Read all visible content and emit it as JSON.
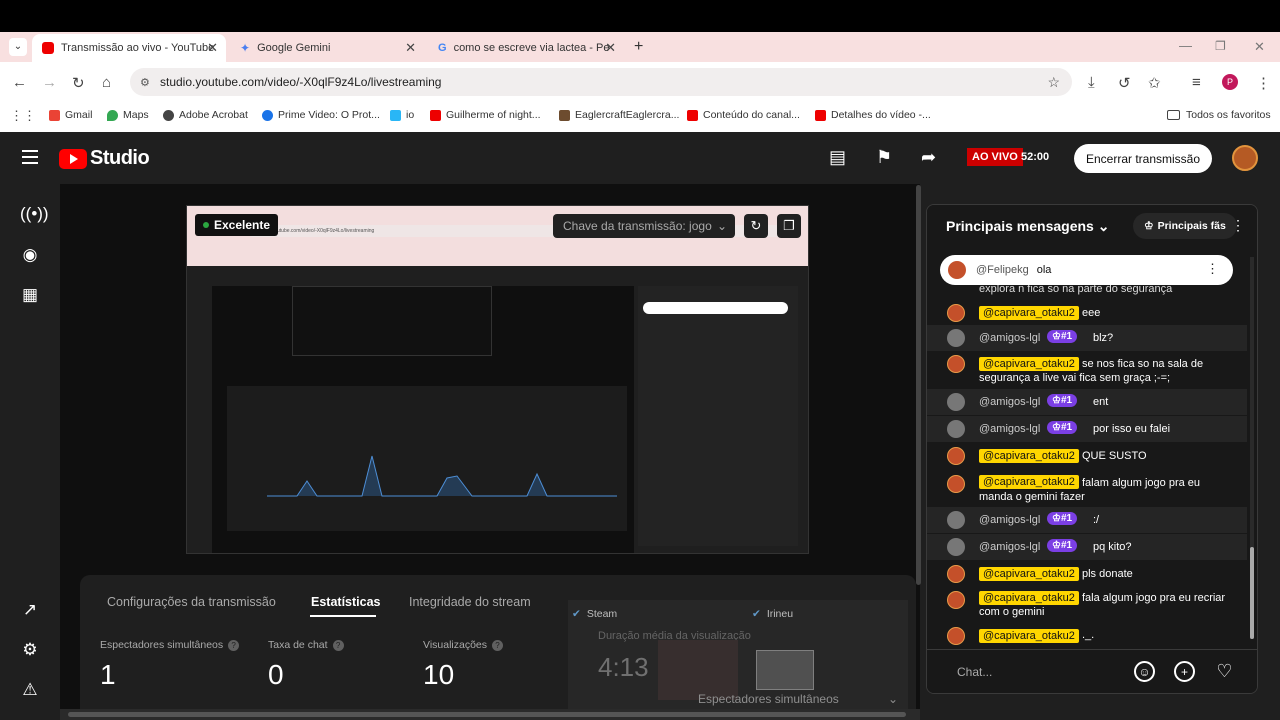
{
  "browser": {
    "tabs": [
      {
        "label": "Transmissão ao vivo - YouTube",
        "active": true,
        "favicon_color": "#e00"
      },
      {
        "label": "Google Gemini",
        "active": false,
        "favicon_color": "#4a7ef0"
      },
      {
        "label": "como se escreve via lactea - Pe",
        "active": false,
        "favicon_color": "#34a853"
      }
    ],
    "url": "studio.youtube.com/video/-X0qlF9z4Lo/livestreaming",
    "profile_initial": "P",
    "bookmarks": [
      {
        "label": "Gmail",
        "color": "#ea4335"
      },
      {
        "label": "Maps",
        "color": "#34a853"
      },
      {
        "label": "Adobe Acrobat",
        "color": "#444"
      },
      {
        "label": "Prime Video: O Prot...",
        "color": "#1a73e8"
      },
      {
        "label": "io",
        "color": "#29b6f6"
      },
      {
        "label": "Guilherme of night...",
        "color": "#e00"
      },
      {
        "label": "EaglercraftEaglercra...",
        "color": "#6d4c2f"
      },
      {
        "label": "Conteúdo do canal...",
        "color": "#e00"
      },
      {
        "label": "Detalhes do vídeo -...",
        "color": "#e00"
      }
    ],
    "all_bookmarks": "Todos os favoritos"
  },
  "studio": {
    "logo_text": "Studio",
    "live_badge": "AO VIVO",
    "live_time": "52:00",
    "end_button": "Encerrar transmissão"
  },
  "preview": {
    "quality": "Excelente",
    "stream_key": "Chave da transmissão: jogo"
  },
  "stats": {
    "tabs": [
      "Configurações da transmissão",
      "Estatísticas",
      "Integridade do stream"
    ],
    "metrics": [
      {
        "label": "Espectadores simultâneos",
        "value": "1"
      },
      {
        "label": "Taxa de chat",
        "value": "0"
      },
      {
        "label": "Visualizações",
        "value": "10"
      }
    ],
    "overlay": {
      "steam": "Steam",
      "irineu": "Irineu",
      "ghost_label": "Duração média da visualização",
      "ghost_value": "4:13",
      "ghost_bottom": "Espectadores simultâneos"
    }
  },
  "chat": {
    "title": "Principais mensagens",
    "top_fans": "Principais fãs",
    "pinned": {
      "user": "@Felipekg",
      "text": "ola"
    },
    "partial_line": "explora n fica so na parte do segurança",
    "messages": [
      {
        "user": "@capivara_otaku2",
        "style": "yellow",
        "badge": "",
        "text": "eee"
      },
      {
        "user": "@amigos-lgl",
        "style": "white",
        "badge": "#1",
        "text": "blz?"
      },
      {
        "user": "@capivara_otaku2",
        "style": "yellow",
        "badge": "",
        "text": "se nos fica so na sala de segurança a live vai fica sem graça ;-=;"
      },
      {
        "user": "@amigos-lgl",
        "style": "white",
        "badge": "#1",
        "text": "ent"
      },
      {
        "user": "@amigos-lgl",
        "style": "white",
        "badge": "#1",
        "text": "por isso eu falei"
      },
      {
        "user": "@capivara_otaku2",
        "style": "yellow",
        "badge": "",
        "text": "QUE SUSTO"
      },
      {
        "user": "@capivara_otaku2",
        "style": "yellow",
        "badge": "",
        "text": "falam algum jogo pra eu manda o gemini fazer"
      },
      {
        "user": "@amigos-lgl",
        "style": "white",
        "badge": "#1",
        "text": ":/"
      },
      {
        "user": "@amigos-lgl",
        "style": "white",
        "badge": "#1",
        "text": "pq kito?"
      },
      {
        "user": "@capivara_otaku2",
        "style": "yellow",
        "badge": "",
        "text": "pls donate"
      },
      {
        "user": "@capivara_otaku2",
        "style": "yellow",
        "badge": "",
        "text": "fala algum jogo pra eu recriar com o gemini"
      },
      {
        "user": "@capivara_otaku2",
        "style": "yellow",
        "badge": "",
        "text": "._."
      }
    ],
    "input_placeholder": "Chat..."
  }
}
